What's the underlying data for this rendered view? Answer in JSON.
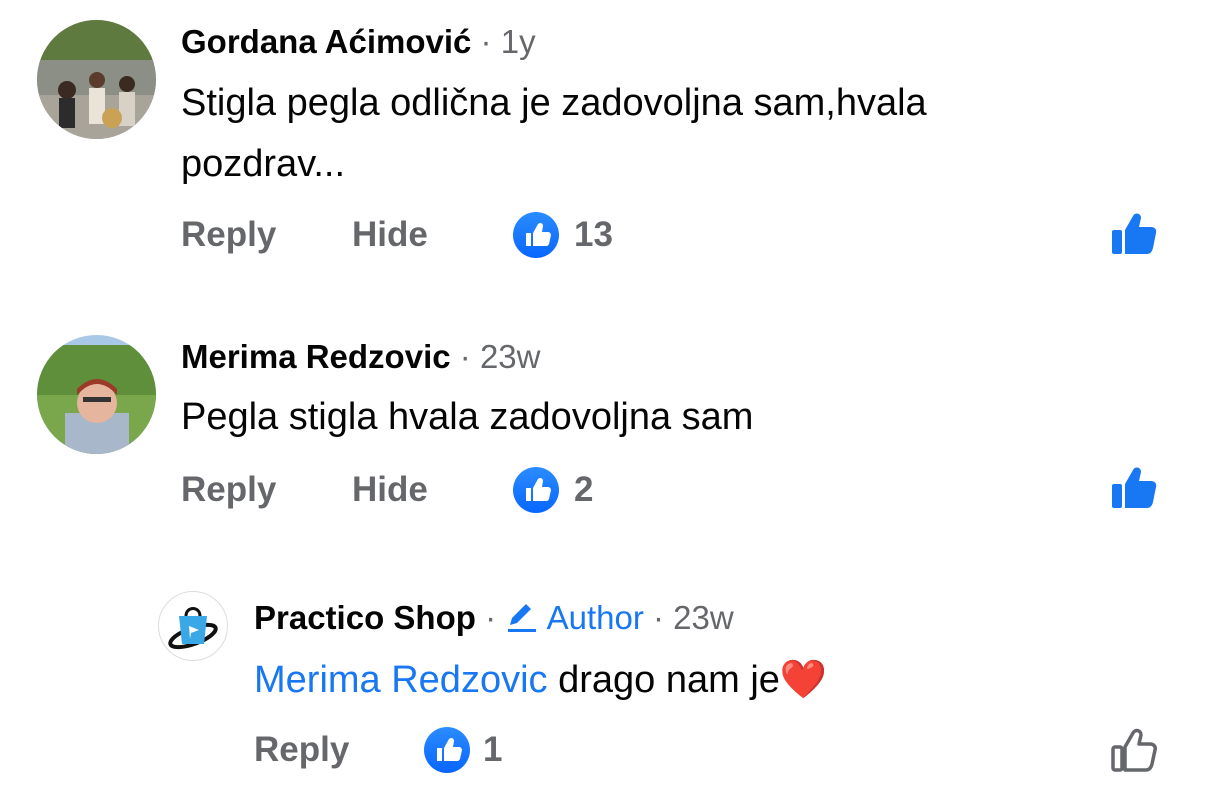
{
  "comments": [
    {
      "author": "Gordana Aćimović",
      "sep": "·",
      "time": "1y",
      "text_line1": "Stigla pegla odlična je zadovoljna sam,hvala",
      "text_line2": "pozdrav...",
      "reply_label": "Reply",
      "hide_label": "Hide",
      "likes": "13",
      "liked": true
    },
    {
      "author": "Merima Redzovic",
      "sep": "·",
      "time": "23w",
      "text_line1": "Pegla stigla hvala zadovoljna sam",
      "reply_label": "Reply",
      "hide_label": "Hide",
      "likes": "2",
      "liked": true
    }
  ],
  "reply": {
    "author": "Practico Shop",
    "sep1": "·",
    "author_badge": "Author",
    "sep2": "·",
    "time": "23w",
    "mention": "Merima Redzovic",
    "text": " drago nam je",
    "emoji": "❤️",
    "reply_label": "Reply",
    "likes": "1",
    "liked": false
  },
  "colors": {
    "accent": "#1877f2",
    "secondary_text": "#65676b",
    "primary_text": "#050505"
  },
  "icons": [
    "like-badge-icon",
    "thumbs-up-icon",
    "pencil-icon",
    "heart-emoji-icon"
  ]
}
